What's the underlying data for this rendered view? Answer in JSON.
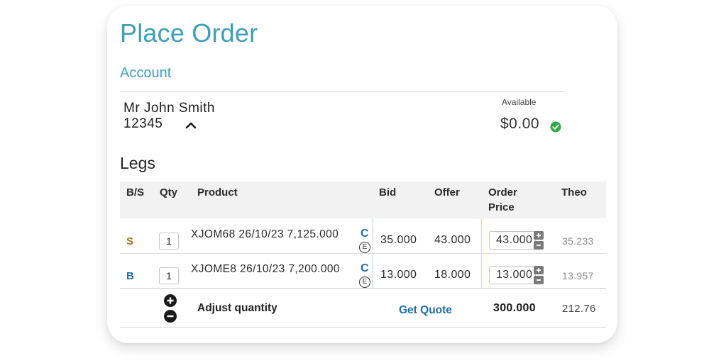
{
  "title": "Place Order",
  "account": {
    "heading": "Account",
    "name": "Mr John Smith",
    "number": "12345",
    "available_label": "Available",
    "available_value": "$0.00",
    "status_icon": "check-circle-icon",
    "status_color": "#2eaa46"
  },
  "legs": {
    "heading": "Legs",
    "columns": {
      "bs": "B/S",
      "qty": "Qty",
      "product": "Product",
      "bid": "Bid",
      "offer": "Offer",
      "order_price": "Order Price",
      "theo": "Theo"
    },
    "rows": [
      {
        "side": "S",
        "side_color": "#9a7220",
        "qty": "1",
        "product": "XJOM68 26/10/23 7,125.000",
        "type": "C",
        "style": "E",
        "bid": "35.000",
        "offer": "43.000",
        "order_price": "43.000",
        "theo": "35.233"
      },
      {
        "side": "B",
        "side_color": "#1f6fa8",
        "qty": "1",
        "product": "XJOME8 26/10/23 7,200.000",
        "type": "C",
        "style": "E",
        "bid": "13.000",
        "offer": "18.000",
        "order_price": "13.000",
        "theo": "13.957"
      }
    ],
    "footer": {
      "adjust_label": "Adjust quantity",
      "get_quote": "Get Quote",
      "total_order_price": "300.000",
      "total_theo": "212.76"
    }
  },
  "colors": {
    "accent": "#3e9fb6",
    "link": "#1f6fa8"
  }
}
